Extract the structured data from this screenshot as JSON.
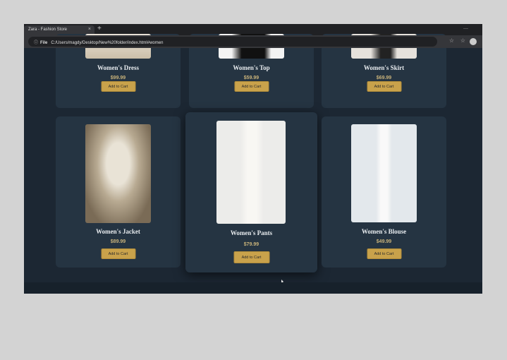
{
  "browser": {
    "tab_title": "Zara - Fashion Store",
    "new_tab": "+",
    "close": "×",
    "file_label": "File",
    "url": "C:/Users/magdy/Desktop/New%20folder/index.html#women"
  },
  "products": [
    {
      "name": "Women's Dress",
      "price": "$99.99",
      "button": "Add to Cart"
    },
    {
      "name": "Women's Top",
      "price": "$59.99",
      "button": "Add to Cart"
    },
    {
      "name": "Women's Skirt",
      "price": "$69.99",
      "button": "Add to Cart"
    },
    {
      "name": "Women's Jacket",
      "price": "$89.99",
      "button": "Add to Cart"
    },
    {
      "name": "Women's Pants",
      "price": "$79.99",
      "button": "Add to Cart"
    },
    {
      "name": "Women's Blouse",
      "price": "$49.99",
      "button": "Add to Cart"
    }
  ]
}
